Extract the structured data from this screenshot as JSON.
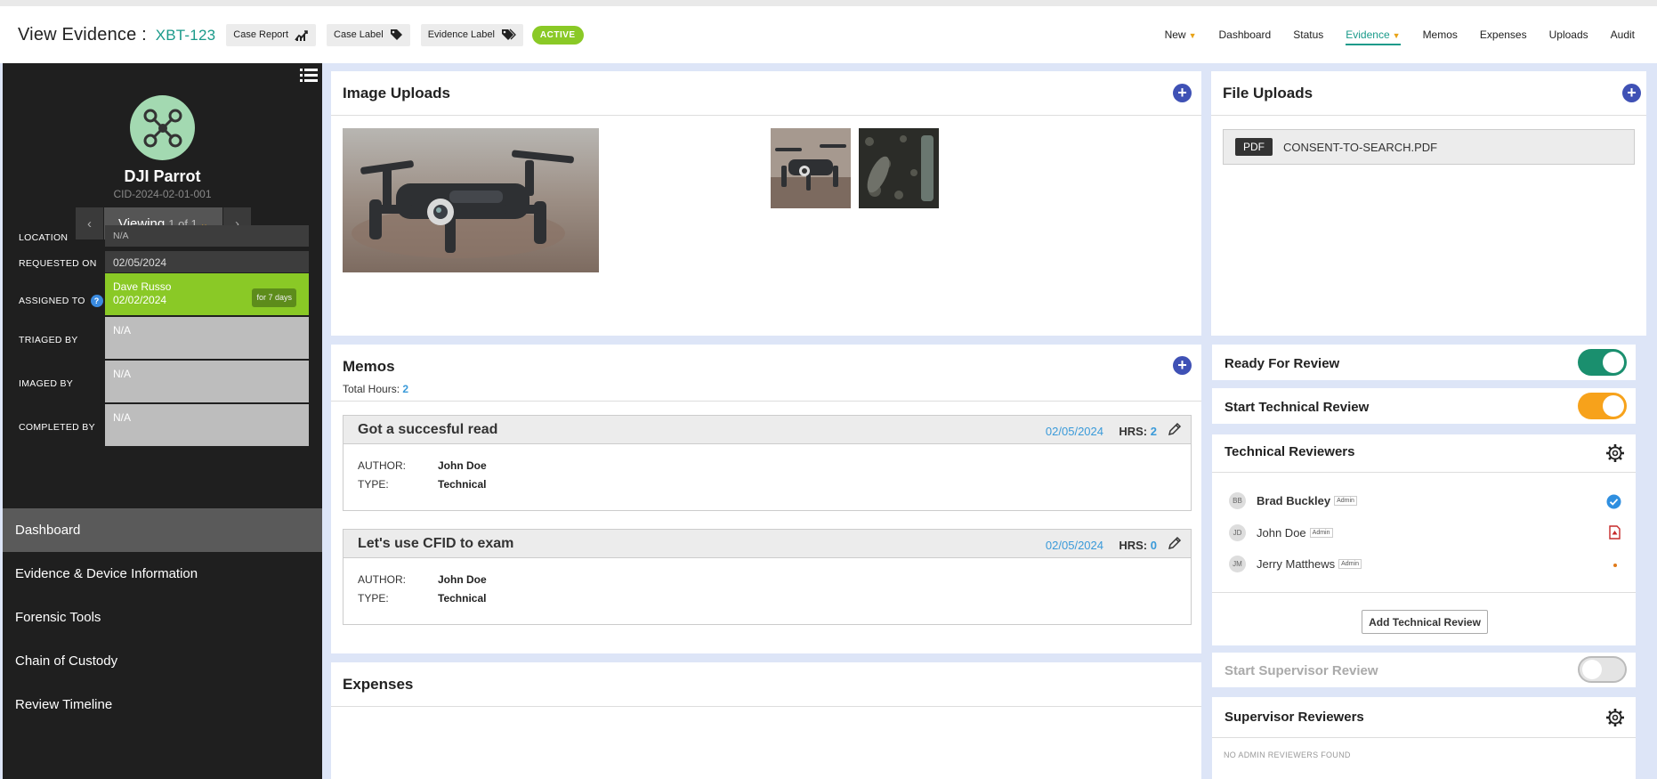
{
  "header": {
    "title_prefix": "View Evidence :",
    "case_id": "XBT-123",
    "case_report_label": "Case Report",
    "case_label_label": "Case Label",
    "evidence_label_label": "Evidence Label",
    "status_badge": "ACTIVE",
    "nav": [
      "New",
      "Dashboard",
      "Status",
      "Evidence",
      "Memos",
      "Expenses",
      "Uploads",
      "Audit"
    ],
    "active_nav": "Evidence"
  },
  "sidebar": {
    "device_name": "DJI Parrot",
    "device_cid": "CID-2024-02-01-001",
    "pager": {
      "label": "Viewing",
      "position": "1 of 1"
    },
    "info": {
      "location_label": "LOCATION",
      "location_value": "N/A",
      "requested_label": "REQUESTED ON",
      "requested_value": "02/05/2024",
      "assigned_label": "ASSIGNED TO",
      "assigned_name": "Dave Russo",
      "assigned_date": "02/02/2024",
      "assigned_duration": "for 7 days",
      "triaged_label": "TRIAGED BY",
      "triaged_value": "N/A",
      "imaged_label": "IMAGED BY",
      "imaged_value": "N/A",
      "completed_label": "COMPLETED BY",
      "completed_value": "N/A"
    },
    "menu": [
      "Dashboard",
      "Evidence & Device Information",
      "Forensic Tools",
      "Chain of Custody",
      "Review Timeline"
    ]
  },
  "image_uploads": {
    "title": "Image Uploads"
  },
  "file_uploads": {
    "title": "File Uploads",
    "file_type": "PDF",
    "file_name": "CONSENT-TO-SEARCH.PDF"
  },
  "memos": {
    "title": "Memos",
    "total_hours_label": "Total Hours:",
    "total_hours": "2",
    "author_label": "AUTHOR:",
    "type_label": "TYPE:",
    "hrs_label": "HRS:",
    "items": [
      {
        "title": "Got a succesful read",
        "date": "02/05/2024",
        "hrs": "2",
        "author": "John Doe",
        "type": "Technical"
      },
      {
        "title": "Let's use CFID to exam",
        "date": "02/05/2024",
        "hrs": "0",
        "author": "John Doe",
        "type": "Technical"
      }
    ]
  },
  "expenses": {
    "title": "Expenses"
  },
  "review": {
    "ready_for_review": "Ready For Review",
    "start_technical_review": "Start Technical Review",
    "technical_reviewers_title": "Technical Reviewers",
    "reviewers": [
      {
        "initials": "BB",
        "name": "Brad Buckley",
        "role": "Admin"
      },
      {
        "initials": "JD",
        "name": "John Doe",
        "role": "Admin"
      },
      {
        "initials": "JM",
        "name": "Jerry Matthews",
        "role": "Admin"
      }
    ],
    "add_technical_review": "Add Technical Review",
    "start_supervisor_review": "Start Supervisor Review",
    "supervisor_reviewers_title": "Supervisor Reviewers",
    "no_admin_reviewers": "NO ADMIN REVIEWERS FOUND"
  },
  "colors": {
    "accent": "#1a9a8a",
    "active_green": "#8ac926",
    "toggle_green": "#1a8f6e",
    "toggle_orange": "#f7a21b",
    "plus_blue": "#3f51b5"
  }
}
